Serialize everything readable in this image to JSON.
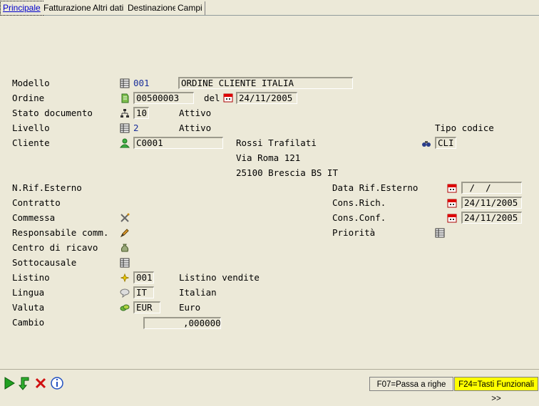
{
  "tabs": [
    "Principale",
    "Fatturazione",
    "Altri dati",
    "Destinazione",
    "Campi"
  ],
  "labels": {
    "modello": "Modello",
    "ordine": "Ordine",
    "stato": "Stato documento",
    "livello": "Livello",
    "cliente": "Cliente",
    "nrif": "N.Rif.Esterno",
    "contratto": "Contratto",
    "commessa": "Commessa",
    "responsabile": "Responsabile comm.",
    "centro": "Centro di ricavo",
    "sottocausale": "Sottocausale",
    "listino": "Listino",
    "lingua": "Lingua",
    "valuta": "Valuta",
    "cambio": "Cambio",
    "del": "del",
    "tipo_codice": "Tipo codice",
    "data_rif": "Data Rif.Esterno",
    "cons_rich": "Cons.Rich.",
    "cons_conf": "Cons.Conf.",
    "priorita": "Priorità"
  },
  "values": {
    "modello_code": "001",
    "modello_desc": "ORDINE CLIENTE ITALIA",
    "ordine_num": "00500003",
    "ordine_date": "24/11/2005",
    "stato_code": "10",
    "stato_desc": "Attivo",
    "livello_code": "2",
    "livello_desc": "Attivo",
    "cliente_code": "C0001",
    "cliente_name": "Rossi Trafilati",
    "cliente_addr1": "Via Roma 121",
    "cliente_addr2": "25100 Brescia BS IT",
    "tipo_codice": "CLI",
    "data_rif": " /  /",
    "cons_rich": "24/11/2005",
    "cons_conf": "24/11/2005",
    "listino_code": "001",
    "listino_desc": "Listino vendite",
    "lingua_code": "IT",
    "lingua_desc": "Italian",
    "valuta_code": "EUR",
    "valuta_desc": "Euro",
    "cambio": ",000000"
  },
  "footer": {
    "f07": "F07=Passa a righe",
    "f24": "F24=Tasti Funzionali >>"
  },
  "colors": {
    "f24_bg": "#ffff00",
    "label_blue": "#1a2f9a"
  }
}
